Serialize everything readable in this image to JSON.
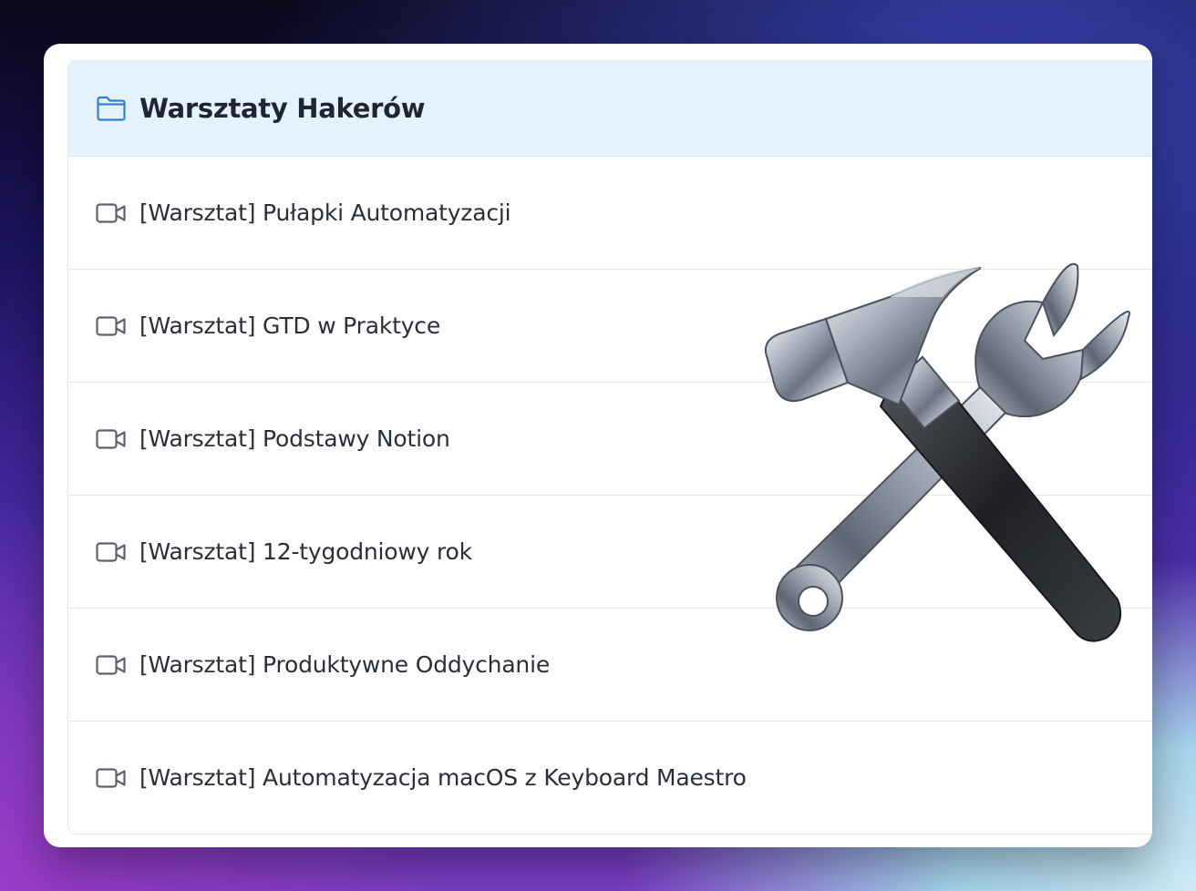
{
  "folder": {
    "title": "Warsztaty Hakerów",
    "icon": "folder-icon",
    "accent": "#2f7fd8"
  },
  "items": [
    {
      "label": "[Warsztat] Pułapki Automatyzacji",
      "icon": "video-icon"
    },
    {
      "label": "[Warsztat] GTD w Praktyce",
      "icon": "video-icon"
    },
    {
      "label": "[Warsztat] Podstawy Notion",
      "icon": "video-icon"
    },
    {
      "label": "[Warsztat] 12-tygodniowy rok",
      "icon": "video-icon"
    },
    {
      "label": "[Warsztat] Produktywne Oddychanie",
      "icon": "video-icon"
    },
    {
      "label": "[Warsztat] Automatyzacja macOS z Keyboard Maestro",
      "icon": "video-icon"
    }
  ],
  "overlay": {
    "icon": "hammer-and-wrench-icon"
  },
  "colors": {
    "header_bg": "#e5f2fc",
    "text": "#2a2f36",
    "icon_gray": "#5b626b"
  }
}
